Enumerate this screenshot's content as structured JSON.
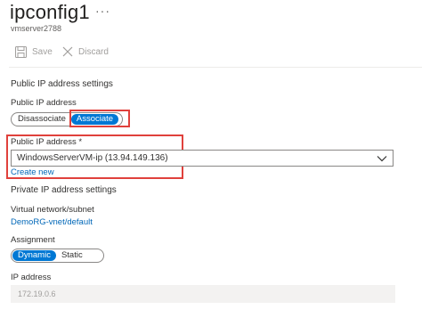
{
  "header": {
    "title": "ipconfig1",
    "more_label": "···",
    "subtitle": "vmserver2788"
  },
  "toolbar": {
    "save_label": "Save",
    "discard_label": "Discard"
  },
  "public_ip_section": {
    "heading": "Public IP address settings",
    "toggle_label": "Public IP address",
    "options": [
      "Disassociate",
      "Associate"
    ],
    "selected": "Associate",
    "select_label": "Public IP address *",
    "select_value": "WindowsServerVM-ip (13.94.149.136)",
    "create_new_label": "Create new"
  },
  "private_ip_section": {
    "heading": "Private IP address settings",
    "vnet_label": "Virtual network/subnet",
    "vnet_value": "DemoRG-vnet/default",
    "assignment_label": "Assignment",
    "assignment_options": [
      "Dynamic",
      "Static"
    ],
    "assignment_selected": "Dynamic",
    "ip_label": "IP address",
    "ip_value": "172.19.0.6"
  },
  "colors": {
    "accent": "#0078d4",
    "link": "#0067b8",
    "highlight_box": "#e0413c"
  }
}
